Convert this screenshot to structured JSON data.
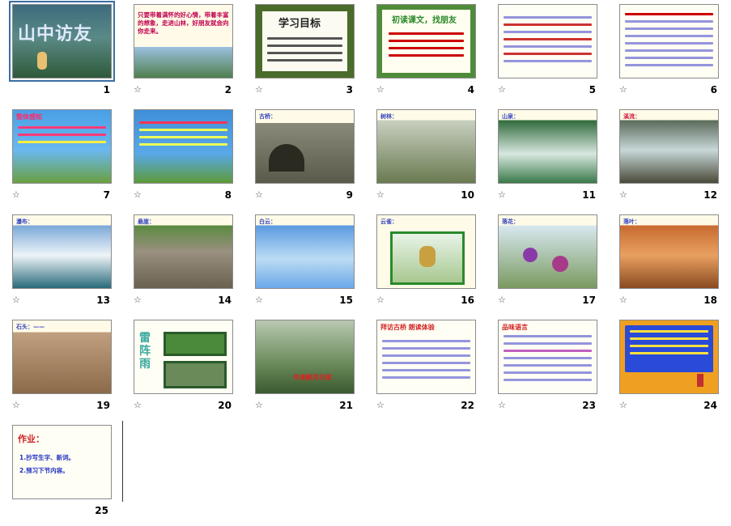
{
  "slides": [
    {
      "num": "1",
      "title": "山中访友"
    },
    {
      "num": "2",
      "title": "只要带着满怀的好心情，带着丰富的想象，走进山林，好朋友就会向你走来。"
    },
    {
      "num": "3",
      "title": "学习目标"
    },
    {
      "num": "4",
      "title": "初读课文，找朋友"
    },
    {
      "num": "5",
      "title": ""
    },
    {
      "num": "6",
      "title": ""
    },
    {
      "num": "7",
      "title": "整体感知"
    },
    {
      "num": "8",
      "title": ""
    },
    {
      "num": "9",
      "title": "古桥："
    },
    {
      "num": "10",
      "title": "树林："
    },
    {
      "num": "11",
      "title": "山泉："
    },
    {
      "num": "12",
      "title": "溪流："
    },
    {
      "num": "13",
      "title": "瀑布："
    },
    {
      "num": "14",
      "title": "悬崖："
    },
    {
      "num": "15",
      "title": "白云："
    },
    {
      "num": "16",
      "title": "云雀："
    },
    {
      "num": "17",
      "title": "落花："
    },
    {
      "num": "18",
      "title": "落叶："
    },
    {
      "num": "19",
      "title": "石头：——"
    },
    {
      "num": "20",
      "title": "雷阵雨"
    },
    {
      "num": "21",
      "title": "作者醉月归来"
    },
    {
      "num": "22",
      "title": "拜访古桥  朗读体验"
    },
    {
      "num": "23",
      "title": "品味语言"
    },
    {
      "num": "24",
      "title": ""
    },
    {
      "num": "25",
      "title": "作业：",
      "items": [
        "1.抄写生字、新词。",
        "2.预习下节内容。"
      ]
    }
  ],
  "icons": {
    "transition": "star-icon"
  },
  "transition_glyph": "☆"
}
